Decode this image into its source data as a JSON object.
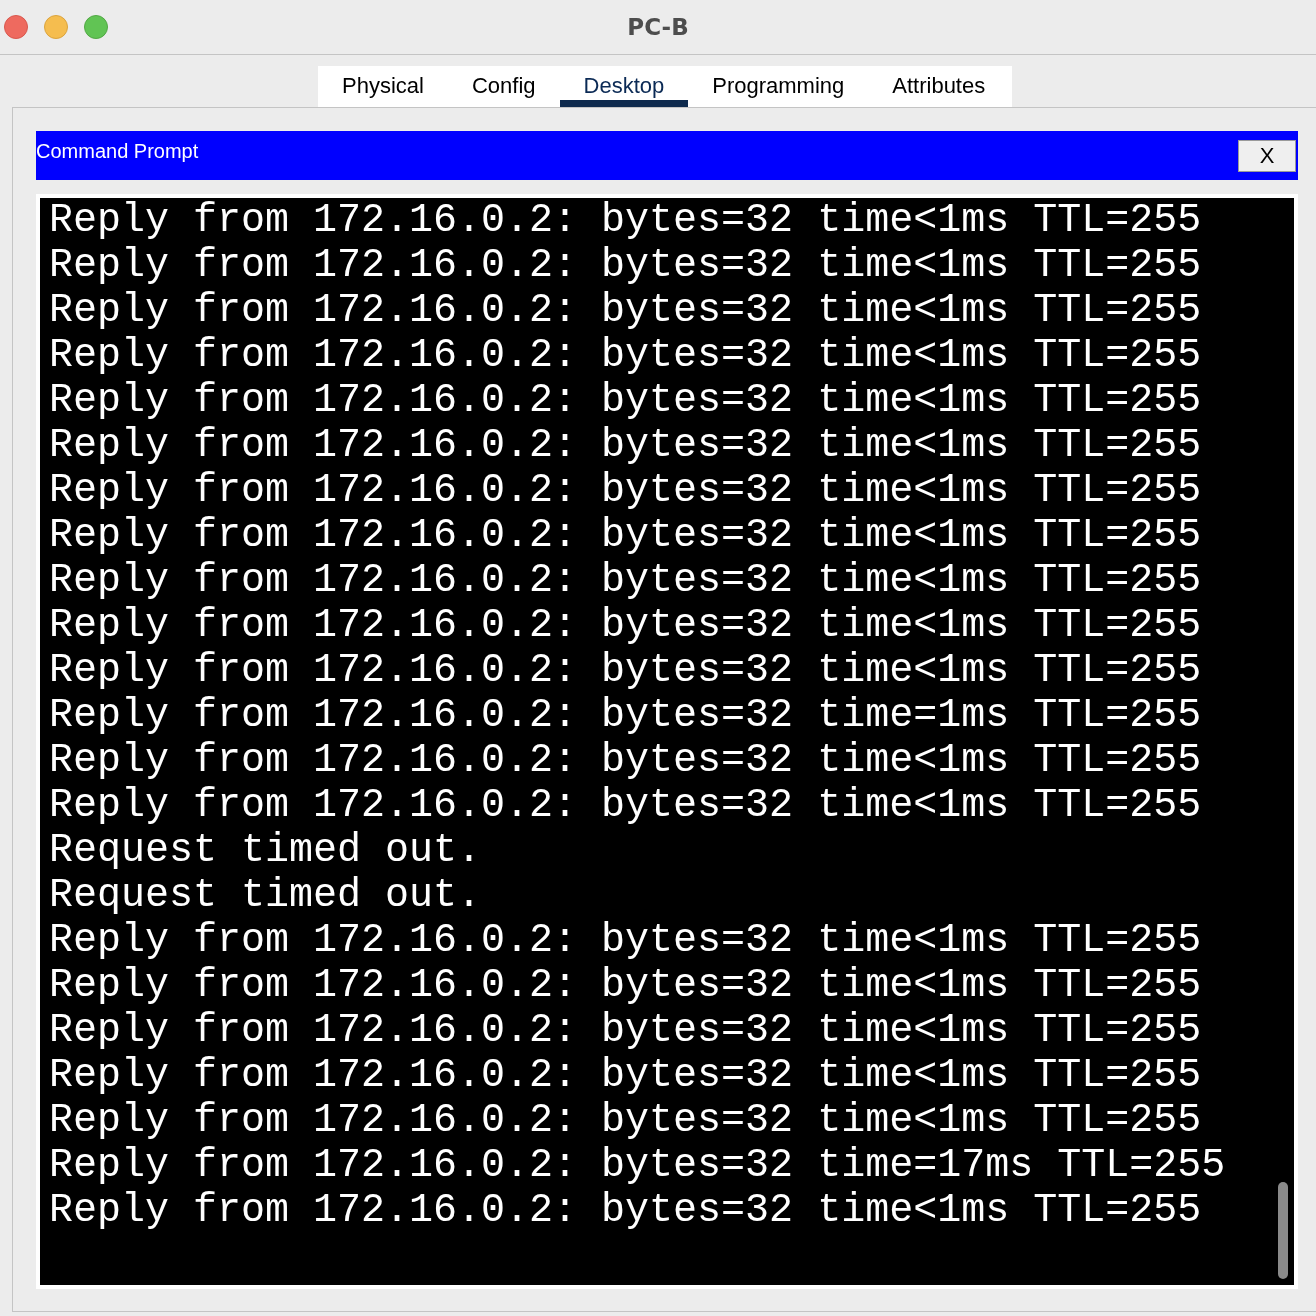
{
  "window": {
    "title": "PC-B"
  },
  "tabs": [
    {
      "label": "Physical",
      "selected": false
    },
    {
      "label": "Config",
      "selected": false
    },
    {
      "label": "Desktop",
      "selected": true
    },
    {
      "label": "Programming",
      "selected": false
    },
    {
      "label": "Attributes",
      "selected": false
    }
  ],
  "command_prompt": {
    "title": "Command Prompt",
    "close_button": "X",
    "lines": [
      "Reply from 172.16.0.2: bytes=32 time<1ms TTL=255",
      "Reply from 172.16.0.2: bytes=32 time<1ms TTL=255",
      "Reply from 172.16.0.2: bytes=32 time<1ms TTL=255",
      "Reply from 172.16.0.2: bytes=32 time<1ms TTL=255",
      "Reply from 172.16.0.2: bytes=32 time<1ms TTL=255",
      "Reply from 172.16.0.2: bytes=32 time<1ms TTL=255",
      "Reply from 172.16.0.2: bytes=32 time<1ms TTL=255",
      "Reply from 172.16.0.2: bytes=32 time<1ms TTL=255",
      "Reply from 172.16.0.2: bytes=32 time<1ms TTL=255",
      "Reply from 172.16.0.2: bytes=32 time<1ms TTL=255",
      "Reply from 172.16.0.2: bytes=32 time<1ms TTL=255",
      "Reply from 172.16.0.2: bytes=32 time=1ms TTL=255",
      "Reply from 172.16.0.2: bytes=32 time<1ms TTL=255",
      "Reply from 172.16.0.2: bytes=32 time<1ms TTL=255",
      "Request timed out.",
      "Request timed out.",
      "Reply from 172.16.0.2: bytes=32 time<1ms TTL=255",
      "Reply from 172.16.0.2: bytes=32 time<1ms TTL=255",
      "Reply from 172.16.0.2: bytes=32 time<1ms TTL=255",
      "Reply from 172.16.0.2: bytes=32 time<1ms TTL=255",
      "Reply from 172.16.0.2: bytes=32 time<1ms TTL=255",
      "Reply from 172.16.0.2: bytes=32 time=17ms TTL=255",
      "Reply from 172.16.0.2: bytes=32 time<1ms TTL=255"
    ]
  }
}
